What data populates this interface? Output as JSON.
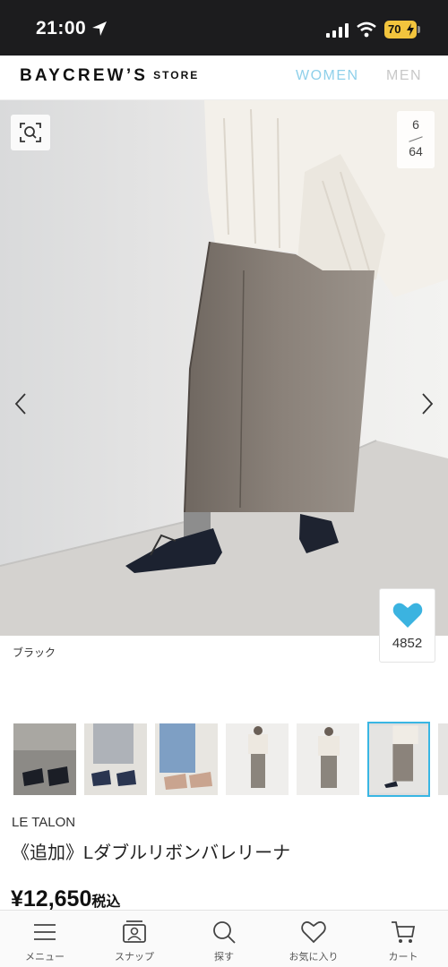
{
  "status_bar": {
    "time": "21:00",
    "battery": "70"
  },
  "header": {
    "logo": "BAYCREW’S",
    "logo_sub": "STORE",
    "nav_women": "WOMEN",
    "nav_men": "MEN"
  },
  "gallery": {
    "current": "6",
    "total": "64"
  },
  "favorite": {
    "count": "4852"
  },
  "product": {
    "color": "ブラック",
    "brand": "LE TALON",
    "name": "《追加》Lダブルリボンバレリーナ",
    "price": "¥12,650",
    "tax_label": "税込"
  },
  "bottom_nav": {
    "items": [
      {
        "label": "メニュー",
        "icon": "menu-icon"
      },
      {
        "label": "スナップ",
        "icon": "snap-icon"
      },
      {
        "label": "探す",
        "icon": "search-icon"
      },
      {
        "label": "お気に入り",
        "icon": "heart-outline-icon"
      },
      {
        "label": "カート",
        "icon": "cart-icon"
      }
    ]
  },
  "colors": {
    "accent": "#39b6e3",
    "favorite": "#3bb3e0",
    "women": "#8fd0ea"
  }
}
